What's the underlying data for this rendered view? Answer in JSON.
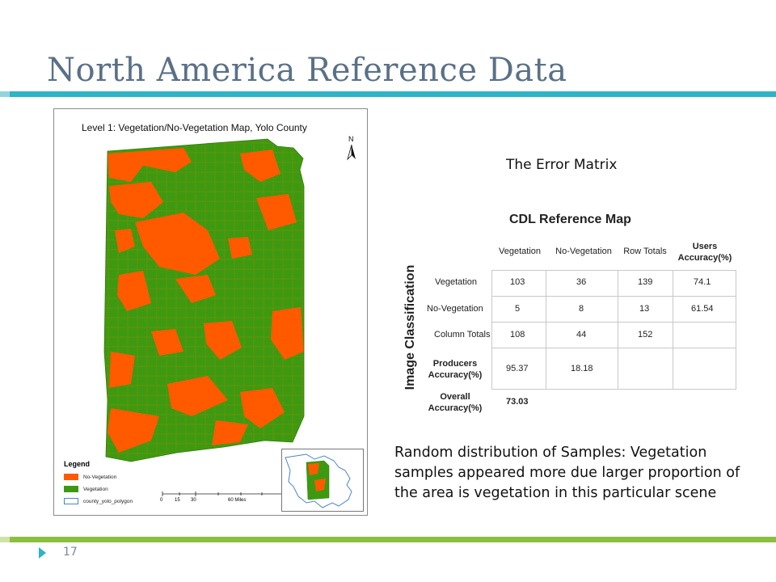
{
  "slide": {
    "title": "North America Reference Data",
    "number": "17",
    "colors": {
      "title": "#5a7087",
      "top_rule": "#2fb3c6",
      "bottom_rule": "#8cbf3f"
    }
  },
  "map": {
    "title": "Level 1: Vegetation/No-Vegetation Map, Yolo County",
    "north_label": "N",
    "legend": {
      "title": "Legend",
      "items": [
        {
          "label": "No-Vegetation",
          "color": "#ff5a00"
        },
        {
          "label": "Vegetation",
          "color": "#3d9a10"
        },
        {
          "label": "county_yolo_polygon",
          "color": "#4a86c8"
        }
      ]
    },
    "scale": {
      "ticks": [
        "0",
        "15",
        "30",
        "60 Miles"
      ]
    }
  },
  "matrix": {
    "heading": "The Error Matrix",
    "reference_title": "CDL Reference Map",
    "classification_title": "Image Classification",
    "columns": [
      "Vegetation",
      "No-Vegetation",
      "Row Totals",
      "Users Accuracy(%)"
    ],
    "rows": [
      {
        "label": "Vegetation",
        "values": [
          "103",
          "36",
          "139",
          "74.1"
        ]
      },
      {
        "label": "No-Vegetation",
        "values": [
          "5",
          "8",
          "13",
          "61.54"
        ]
      },
      {
        "label": "Column Totals",
        "values": [
          "108",
          "44",
          "152",
          ""
        ]
      },
      {
        "label": "Producers Accuracy(%)",
        "values": [
          "95.37",
          "18.18",
          "",
          ""
        ]
      },
      {
        "label": "Overall Accuracy(%)",
        "values": [
          "73.03",
          "",
          "",
          ""
        ]
      }
    ]
  },
  "body_text": "Random distribution of Samples: Vegetation samples appeared more due larger proportion of the area is vegetation in this particular scene"
}
